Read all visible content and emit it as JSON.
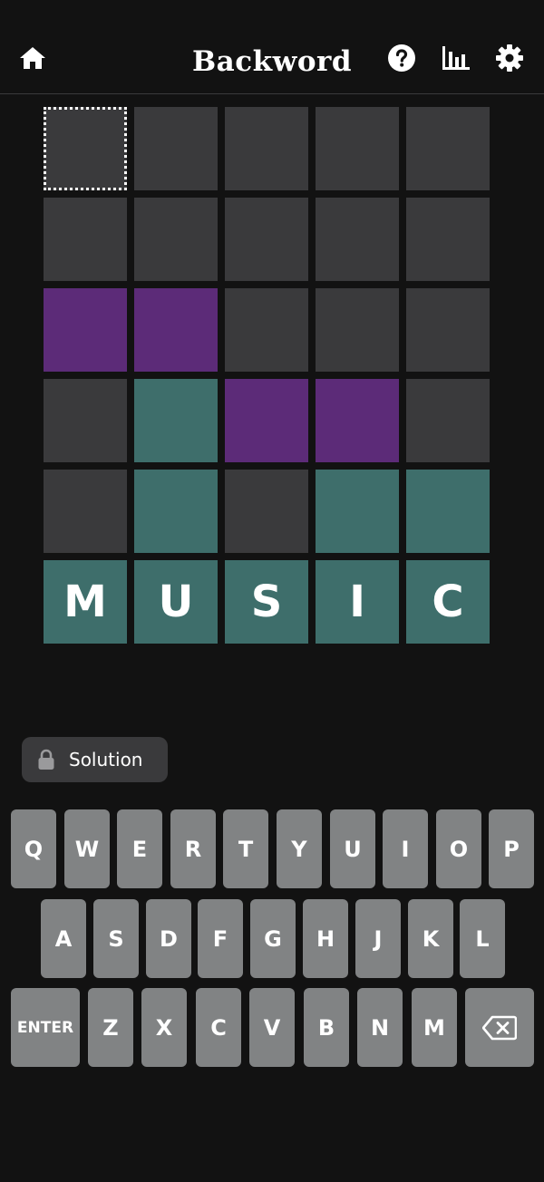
{
  "app": {
    "title": "Backword"
  },
  "header": {
    "icons": [
      "home-icon",
      "help-icon",
      "stats-icon",
      "settings-icon"
    ]
  },
  "colors": {
    "background": "#121212",
    "empty": "#3a3a3c",
    "purple": "#5c2b78",
    "teal": "#3e6e6b",
    "key": "#818384"
  },
  "board": {
    "rows": [
      {
        "tiles": [
          {
            "state": "selected",
            "letter": ""
          },
          {
            "state": "empty",
            "letter": ""
          },
          {
            "state": "empty",
            "letter": ""
          },
          {
            "state": "empty",
            "letter": ""
          },
          {
            "state": "empty",
            "letter": ""
          }
        ]
      },
      {
        "tiles": [
          {
            "state": "empty",
            "letter": ""
          },
          {
            "state": "empty",
            "letter": ""
          },
          {
            "state": "empty",
            "letter": ""
          },
          {
            "state": "empty",
            "letter": ""
          },
          {
            "state": "empty",
            "letter": ""
          }
        ]
      },
      {
        "tiles": [
          {
            "state": "purple",
            "letter": ""
          },
          {
            "state": "purple",
            "letter": ""
          },
          {
            "state": "empty",
            "letter": ""
          },
          {
            "state": "empty",
            "letter": ""
          },
          {
            "state": "empty",
            "letter": ""
          }
        ]
      },
      {
        "tiles": [
          {
            "state": "empty",
            "letter": ""
          },
          {
            "state": "teal",
            "letter": ""
          },
          {
            "state": "purple",
            "letter": ""
          },
          {
            "state": "purple",
            "letter": ""
          },
          {
            "state": "empty",
            "letter": ""
          }
        ]
      },
      {
        "tiles": [
          {
            "state": "empty",
            "letter": ""
          },
          {
            "state": "teal",
            "letter": ""
          },
          {
            "state": "empty",
            "letter": ""
          },
          {
            "state": "teal",
            "letter": ""
          },
          {
            "state": "teal",
            "letter": ""
          }
        ]
      },
      {
        "tiles": [
          {
            "state": "teal",
            "letter": "M"
          },
          {
            "state": "teal",
            "letter": "U"
          },
          {
            "state": "teal",
            "letter": "S"
          },
          {
            "state": "teal",
            "letter": "I"
          },
          {
            "state": "teal",
            "letter": "C"
          }
        ]
      }
    ]
  },
  "solution": {
    "label": "Solution",
    "icon": "lock-icon"
  },
  "keyboard": {
    "row1": [
      "Q",
      "W",
      "E",
      "R",
      "T",
      "Y",
      "U",
      "I",
      "O",
      "P"
    ],
    "row2": [
      "A",
      "S",
      "D",
      "F",
      "G",
      "H",
      "J",
      "K",
      "L"
    ],
    "row3": [
      "ENTER",
      "Z",
      "X",
      "C",
      "V",
      "B",
      "N",
      "M"
    ],
    "backspace_icon": "backspace-icon"
  }
}
